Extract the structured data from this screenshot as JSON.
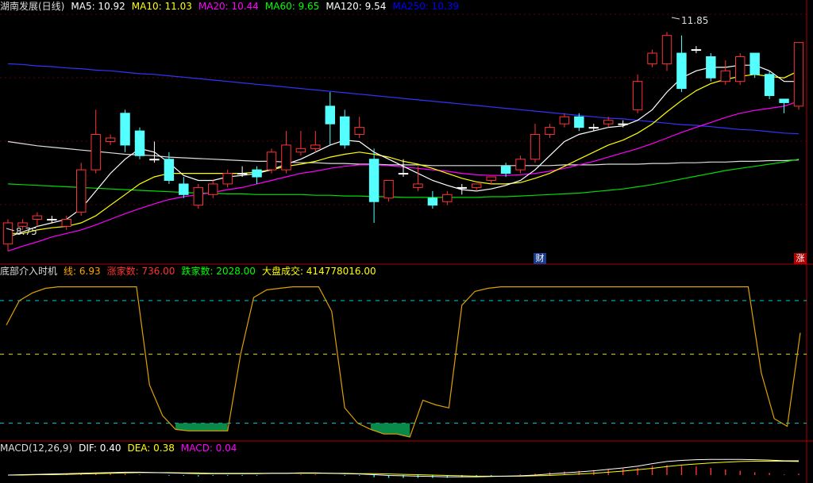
{
  "main_header": {
    "title": "湖南发展(日线)",
    "ma": [
      {
        "label": "MA5: 10.92",
        "color": "#ffffff"
      },
      {
        "label": "MA10: 11.03",
        "color": "#ffff00"
      },
      {
        "label": "MA20: 10.44",
        "color": "#ff00ff"
      },
      {
        "label": "MA60: 9.65",
        "color": "#00ff00"
      },
      {
        "label": "MA120: 9.54",
        "color": "#ffffff"
      },
      {
        "label": "MA250: 10.39",
        "color": "#0000ff"
      }
    ]
  },
  "price_labels": {
    "high": "11.85",
    "low": "8.75"
  },
  "markers": {
    "cai": "财",
    "zhang": "涨"
  },
  "ind_header": {
    "title": "底部介入时机",
    "items": [
      {
        "label": "线: 6.93",
        "color": "#ffa500"
      },
      {
        "label": "涨家数: 736.00",
        "color": "#ff3333"
      },
      {
        "label": "跌家数: 2028.00",
        "color": "#00ff00"
      },
      {
        "label": "大盘成交: 414778016.00",
        "color": "#ffff00",
        "value_color": "#ffffff"
      }
    ]
  },
  "macd_header": {
    "title": "MACD(12,26,9)",
    "items": [
      {
        "label": "DIF: 0.40",
        "color": "#ffffff"
      },
      {
        "label": "DEA: 0.38",
        "color": "#ffff00"
      },
      {
        "label": "MACD: 0.04",
        "color": "#ff00ff"
      }
    ]
  },
  "colors": {
    "up": "#ff3333",
    "down": "#54ffff",
    "bg": "#000000",
    "frame": "#b00000"
  },
  "chart_data": [
    {
      "type": "candlestick",
      "ylim": [
        8.6,
        12.1
      ],
      "candles": [
        [
          8.85,
          9.15,
          8.75,
          9.2
        ],
        [
          9.1,
          9.15,
          9.05,
          9.2
        ],
        [
          9.2,
          9.25,
          9.1,
          9.3
        ],
        [
          9.2,
          9.2,
          9.15,
          9.25
        ],
        [
          9.1,
          9.2,
          9.05,
          9.25
        ],
        [
          9.3,
          9.9,
          9.25,
          10.0
        ],
        [
          9.9,
          10.4,
          9.85,
          10.75
        ],
        [
          10.3,
          10.35,
          10.25,
          10.4
        ],
        [
          10.7,
          10.25,
          10.15,
          10.75
        ],
        [
          10.45,
          10.1,
          10.05,
          10.5
        ],
        [
          10.05,
          10.05,
          10.0,
          10.3
        ],
        [
          10.05,
          9.75,
          9.7,
          10.15
        ],
        [
          9.7,
          9.55,
          9.5,
          9.8
        ],
        [
          9.4,
          9.65,
          9.35,
          9.7
        ],
        [
          9.55,
          9.7,
          9.5,
          9.75
        ],
        [
          9.7,
          9.85,
          9.65,
          9.9
        ],
        [
          9.85,
          9.85,
          9.8,
          9.95
        ],
        [
          9.9,
          9.8,
          9.7,
          9.95
        ],
        [
          9.9,
          10.15,
          9.85,
          10.2
        ],
        [
          9.9,
          10.25,
          9.85,
          10.45
        ],
        [
          10.15,
          10.2,
          10.1,
          10.45
        ],
        [
          10.2,
          10.25,
          10.15,
          10.45
        ],
        [
          10.8,
          10.55,
          10.25,
          11.0
        ],
        [
          10.65,
          10.25,
          10.2,
          10.75
        ],
        [
          10.4,
          10.5,
          10.35,
          10.65
        ],
        [
          10.05,
          9.45,
          9.15,
          10.2
        ],
        [
          9.5,
          9.75,
          9.45,
          9.75
        ],
        [
          9.85,
          9.85,
          9.8,
          10.05
        ],
        [
          9.65,
          9.7,
          9.6,
          9.95
        ],
        [
          9.5,
          9.4,
          9.35,
          9.6
        ],
        [
          9.45,
          9.55,
          9.4,
          9.6
        ],
        [
          9.65,
          9.65,
          9.55,
          9.7
        ],
        [
          9.65,
          9.7,
          9.6,
          9.7
        ],
        [
          9.75,
          9.8,
          9.7,
          9.8
        ],
        [
          9.95,
          9.85,
          9.8,
          10.0
        ],
        [
          9.9,
          10.05,
          9.85,
          10.1
        ],
        [
          10.05,
          10.4,
          10.0,
          10.55
        ],
        [
          10.4,
          10.5,
          10.35,
          10.55
        ],
        [
          10.55,
          10.65,
          10.5,
          10.7
        ],
        [
          10.65,
          10.5,
          10.45,
          10.7
        ],
        [
          10.5,
          10.5,
          10.45,
          10.55
        ],
        [
          10.55,
          10.6,
          10.5,
          10.65
        ],
        [
          10.55,
          10.55,
          10.5,
          10.6
        ],
        [
          10.75,
          11.15,
          10.7,
          11.25
        ],
        [
          11.4,
          11.55,
          11.35,
          11.6
        ],
        [
          11.4,
          11.8,
          11.3,
          11.85
        ],
        [
          11.55,
          11.05,
          11.0,
          11.8
        ],
        [
          11.6,
          11.6,
          11.55,
          11.65
        ],
        [
          11.5,
          11.2,
          11.15,
          11.55
        ],
        [
          11.15,
          11.3,
          11.1,
          11.45
        ],
        [
          11.15,
          11.5,
          11.1,
          11.55
        ],
        [
          11.55,
          11.25,
          11.2,
          11.55
        ],
        [
          11.25,
          10.95,
          10.9,
          11.3
        ],
        [
          10.9,
          10.85,
          10.7,
          10.9
        ],
        [
          10.8,
          11.7,
          10.75,
          11.7
        ]
      ],
      "ma5": [
        8.95,
        9.02,
        9.1,
        9.15,
        9.2,
        9.35,
        9.6,
        9.85,
        10.05,
        10.2,
        10.15,
        10.0,
        9.82,
        9.75,
        9.75,
        9.8,
        9.82,
        9.85,
        9.9,
        9.98,
        10.05,
        10.15,
        10.25,
        10.32,
        10.3,
        10.15,
        10.05,
        9.95,
        9.85,
        9.75,
        9.68,
        9.62,
        9.6,
        9.63,
        9.68,
        9.75,
        9.9,
        10.1,
        10.3,
        10.4,
        10.45,
        10.5,
        10.52,
        10.6,
        10.75,
        11.0,
        11.2,
        11.3,
        11.35,
        11.35,
        11.38,
        11.38,
        11.3,
        11.15,
        11.15
      ],
      "ma10": [
        9.0,
        9.0,
        9.05,
        9.08,
        9.1,
        9.15,
        9.25,
        9.4,
        9.55,
        9.7,
        9.8,
        9.85,
        9.85,
        9.85,
        9.85,
        9.85,
        9.85,
        9.87,
        9.9,
        9.95,
        9.98,
        10.02,
        10.08,
        10.12,
        10.15,
        10.12,
        10.08,
        10.02,
        9.98,
        9.92,
        9.85,
        9.78,
        9.73,
        9.7,
        9.7,
        9.72,
        9.78,
        9.85,
        9.95,
        10.05,
        10.15,
        10.25,
        10.32,
        10.42,
        10.55,
        10.72,
        10.88,
        11.02,
        11.12,
        11.18,
        11.22,
        11.25,
        11.22,
        11.2,
        11.3
      ],
      "ma20": [
        8.75,
        8.82,
        8.88,
        8.95,
        9.0,
        9.05,
        9.12,
        9.2,
        9.28,
        9.35,
        9.42,
        9.48,
        9.52,
        9.55,
        9.58,
        9.62,
        9.65,
        9.7,
        9.75,
        9.8,
        9.85,
        9.88,
        9.92,
        9.95,
        9.97,
        9.97,
        9.96,
        9.94,
        9.92,
        9.9,
        9.88,
        9.85,
        9.83,
        9.82,
        9.82,
        9.83,
        9.85,
        9.88,
        9.92,
        9.97,
        10.02,
        10.08,
        10.14,
        10.2,
        10.27,
        10.35,
        10.43,
        10.5,
        10.57,
        10.64,
        10.7,
        10.74,
        10.77,
        10.8,
        10.87
      ],
      "ma60": [
        9.7,
        9.69,
        9.68,
        9.67,
        9.66,
        9.65,
        9.64,
        9.63,
        9.62,
        9.61,
        9.6,
        9.59,
        9.58,
        9.57,
        9.57,
        9.56,
        9.56,
        9.55,
        9.55,
        9.55,
        9.55,
        9.54,
        9.54,
        9.53,
        9.53,
        9.52,
        9.52,
        9.51,
        9.51,
        9.51,
        9.51,
        9.51,
        9.51,
        9.52,
        9.52,
        9.53,
        9.54,
        9.55,
        9.56,
        9.57,
        9.59,
        9.61,
        9.63,
        9.66,
        9.69,
        9.73,
        9.77,
        9.81,
        9.85,
        9.89,
        9.92,
        9.95,
        9.98,
        10.01,
        10.05
      ],
      "ma120": [
        10.3,
        10.27,
        10.24,
        10.22,
        10.2,
        10.18,
        10.16,
        10.14,
        10.12,
        10.11,
        10.1,
        10.08,
        10.07,
        10.06,
        10.05,
        10.04,
        10.03,
        10.02,
        10.02,
        10.01,
        10.0,
        10.0,
        9.99,
        9.99,
        9.98,
        9.98,
        9.97,
        9.97,
        9.97,
        9.96,
        9.96,
        9.96,
        9.96,
        9.96,
        9.96,
        9.96,
        9.96,
        9.96,
        9.97,
        9.97,
        9.97,
        9.98,
        9.98,
        9.98,
        9.99,
        9.99,
        10.0,
        10.0,
        10.01,
        10.01,
        10.02,
        10.02,
        10.03,
        10.03,
        10.04
      ],
      "ma250": [
        11.4,
        11.39,
        11.37,
        11.36,
        11.34,
        11.33,
        11.31,
        11.3,
        11.28,
        11.26,
        11.25,
        11.23,
        11.21,
        11.19,
        11.17,
        11.15,
        11.13,
        11.11,
        11.09,
        11.07,
        11.05,
        11.03,
        11.01,
        10.99,
        10.97,
        10.95,
        10.93,
        10.91,
        10.89,
        10.87,
        10.85,
        10.83,
        10.81,
        10.79,
        10.77,
        10.75,
        10.73,
        10.71,
        10.69,
        10.67,
        10.65,
        10.63,
        10.62,
        10.6,
        10.58,
        10.56,
        10.54,
        10.53,
        10.51,
        10.49,
        10.47,
        10.46,
        10.44,
        10.42,
        10.41
      ]
    },
    {
      "type": "line",
      "ylim": [
        0,
        10.5
      ],
      "levels": [
        9,
        5.5,
        1
      ],
      "values": [
        7.4,
        9.0,
        9.5,
        9.8,
        9.9,
        9.9,
        9.9,
        9.9,
        9.9,
        9.9,
        9.9,
        3.5,
        1.5,
        0.6,
        0.5,
        0.5,
        0.5,
        0.5,
        5.5,
        9.2,
        9.7,
        9.8,
        9.9,
        9.9,
        9.9,
        8.3,
        2.0,
        1.0,
        0.6,
        0.3,
        0.3,
        0.1,
        2.5,
        2.2,
        2.0,
        8.7,
        9.6,
        9.8,
        9.9,
        9.9,
        9.9,
        9.9,
        9.9,
        9.9,
        9.9,
        9.9,
        9.9,
        9.9,
        9.9,
        9.9,
        9.9,
        9.9,
        9.9,
        9.9,
        9.9,
        9.9,
        9.9,
        9.9,
        4.3,
        1.3,
        0.8,
        6.9
      ]
    },
    {
      "type": "bar",
      "ylim": [
        -0.2,
        0.6
      ],
      "dif": [
        0.0,
        0.01,
        0.02,
        0.03,
        0.04,
        0.05,
        0.06,
        0.07,
        0.08,
        0.08,
        0.07,
        0.06,
        0.05,
        0.04,
        0.04,
        0.04,
        0.04,
        0.04,
        0.05,
        0.05,
        0.06,
        0.06,
        0.05,
        0.04,
        0.03,
        0.01,
        -0.01,
        -0.02,
        -0.03,
        -0.04,
        -0.05,
        -0.05,
        -0.05,
        -0.04,
        -0.03,
        -0.02,
        0.0,
        0.03,
        0.06,
        0.09,
        0.12,
        0.16,
        0.2,
        0.25,
        0.32,
        0.38,
        0.41,
        0.43,
        0.44,
        0.44,
        0.44,
        0.43,
        0.42,
        0.4,
        0.4
      ],
      "dea": [
        0.0,
        0.0,
        0.01,
        0.01,
        0.02,
        0.03,
        0.04,
        0.05,
        0.06,
        0.07,
        0.07,
        0.07,
        0.06,
        0.06,
        0.05,
        0.05,
        0.05,
        0.05,
        0.05,
        0.05,
        0.05,
        0.05,
        0.05,
        0.05,
        0.04,
        0.04,
        0.03,
        0.02,
        0.01,
        0.0,
        -0.01,
        -0.02,
        -0.03,
        -0.03,
        -0.03,
        -0.03,
        -0.02,
        -0.01,
        0.01,
        0.03,
        0.05,
        0.08,
        0.11,
        0.15,
        0.19,
        0.24,
        0.28,
        0.31,
        0.34,
        0.36,
        0.38,
        0.39,
        0.39,
        0.39,
        0.38
      ],
      "macd": [
        0.0,
        0.02,
        0.02,
        0.04,
        0.04,
        0.04,
        0.04,
        0.04,
        0.04,
        0.02,
        0.0,
        -0.02,
        -0.02,
        -0.04,
        -0.02,
        -0.02,
        -0.02,
        -0.02,
        0.0,
        0.0,
        0.02,
        0.02,
        0.0,
        -0.02,
        -0.02,
        -0.06,
        -0.08,
        -0.08,
        -0.08,
        -0.08,
        -0.08,
        -0.06,
        -0.04,
        -0.02,
        0.0,
        0.02,
        0.04,
        0.08,
        0.1,
        0.12,
        0.14,
        0.16,
        0.18,
        0.2,
        0.26,
        0.28,
        0.26,
        0.24,
        0.2,
        0.16,
        0.12,
        0.08,
        0.06,
        0.02,
        0.04
      ]
    }
  ]
}
